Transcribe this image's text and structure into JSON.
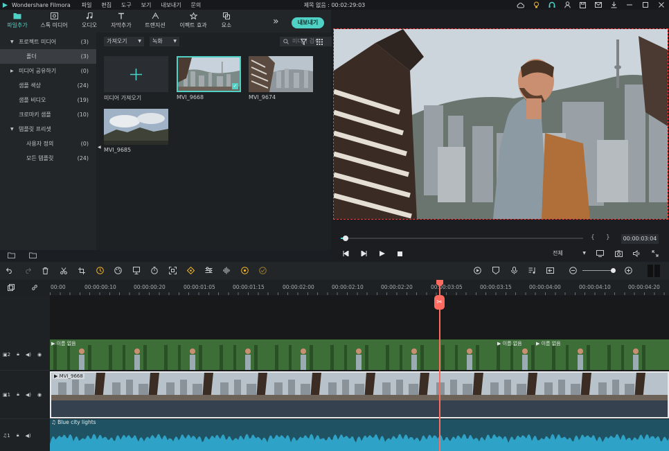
{
  "app": {
    "name": "Wondershare Filmora",
    "menu": [
      "파일",
      "편집",
      "도구",
      "보기",
      "내보내기",
      "문의"
    ],
    "document_title": "제목 없음 : 00:02:29:03"
  },
  "toolbar": {
    "tabs": [
      {
        "label": "파일추가",
        "icon": "folder-icon",
        "active": true
      },
      {
        "label": "스톡 미디어",
        "icon": "stock-media-icon",
        "active": false
      },
      {
        "label": "오디오",
        "icon": "music-note-icon",
        "active": false
      },
      {
        "label": "자막추가",
        "icon": "text-icon",
        "active": false
      },
      {
        "label": "트랜지션",
        "icon": "transition-icon",
        "active": false
      },
      {
        "label": "이펙트 효과",
        "icon": "effects-icon",
        "active": false
      },
      {
        "label": "요소",
        "icon": "elements-icon",
        "active": false
      }
    ],
    "more_label": "»",
    "export_label": "내보내기"
  },
  "sidebar": {
    "items": [
      {
        "label": "프로젝트 미디어",
        "count": "(3)",
        "expanded": true,
        "selected": false
      },
      {
        "label": "폴더",
        "count": "(3)",
        "selected": true
      },
      {
        "label": "미디어 공유하기",
        "count": "(0)",
        "expanded": false,
        "selected": false
      },
      {
        "label": "샘플 색상",
        "count": "(24)",
        "selected": false
      },
      {
        "label": "샘플 비디오",
        "count": "(19)",
        "selected": false
      },
      {
        "label": "크로마키 샘플",
        "count": "(10)",
        "selected": false
      },
      {
        "label": "템플릿 프리셋",
        "count": "",
        "expanded": true,
        "selected": false
      },
      {
        "label": "사용자 정의",
        "count": "(0)",
        "selected": false
      },
      {
        "label": "모든 템플릿",
        "count": "(24)",
        "selected": false
      }
    ]
  },
  "media": {
    "import_dropdown": "가져오기",
    "record_dropdown": "녹화",
    "search_placeholder": "미디어 검색",
    "import_tile_label": "미디어 가져오기",
    "items": [
      {
        "name": "MVI_9668",
        "selected": true
      },
      {
        "name": "MVI_9674",
        "selected": false
      },
      {
        "name": "MVI_9685",
        "selected": false
      }
    ]
  },
  "preview": {
    "timecode": "00:00:03:04",
    "progress": 0.02,
    "quality": "전체",
    "bracket_left": "{",
    "bracket_right": "}"
  },
  "timeline": {
    "ruler": [
      "00:00",
      "00:00:00:10",
      "00:00:00:20",
      "00:00:01:05",
      "00:00:01:15",
      "00:00:02:00",
      "00:00:02:10",
      "00:00:02:20",
      "00:00:03:05",
      "00:00:03:15",
      "00:00:04:00",
      "00:00:04:10",
      "00:00:04:20"
    ],
    "playhead_label": "00:00:03:05",
    "tracks": [
      {
        "id": "2",
        "kind": "video",
        "clip_labels": [
          "이름 없음",
          "이름 없음",
          "이름 없음"
        ]
      },
      {
        "id": "1",
        "kind": "video",
        "clip_label": "MVI_9668"
      },
      {
        "id": "1",
        "kind": "audio",
        "clip_label": "Blue city lights"
      }
    ]
  },
  "colors": {
    "accent": "#4fd1c5",
    "playhead": "#ff6b5e",
    "panel": "#232629",
    "background": "#1b1e22",
    "selection_border": "#ff3b3b",
    "audio_wave": "#2fa3c7"
  }
}
